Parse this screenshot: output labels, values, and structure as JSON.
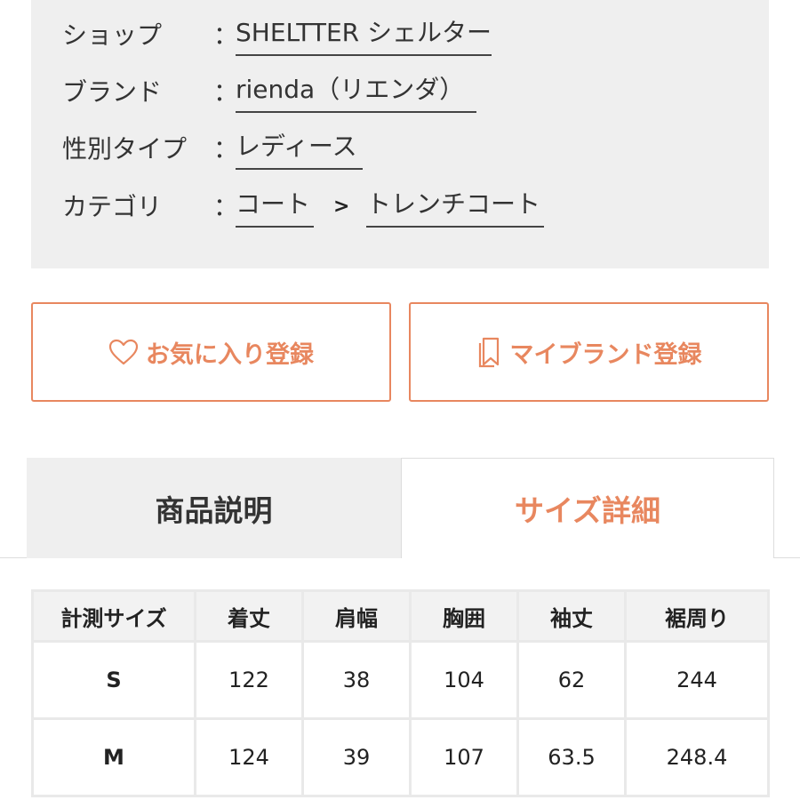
{
  "info": {
    "shop_label": "ショップ",
    "shop_value": "SHELTTER シェルター",
    "brand_label": "ブランド",
    "brand_value": "rienda（リエンダ）",
    "gender_label": "性別タイプ",
    "gender_value": "レディース",
    "category_label": "カテゴリ",
    "category_value": "コート",
    "category_sep": ">",
    "subcategory_value": "トレンチコート",
    "colon": "："
  },
  "buttons": {
    "favorite_label": "お気に入り登録",
    "favorite_icon": "heart-icon",
    "mybrand_label": "マイブランド登録",
    "mybrand_icon": "bookmark-icon",
    "accent_color": "#e8875f"
  },
  "tabs": {
    "description_label": "商品説明",
    "size_label": "サイズ詳細",
    "active": "size"
  },
  "size_table": {
    "headers": [
      "計測サイズ",
      "着丈",
      "肩幅",
      "胸囲",
      "袖丈",
      "裾周り"
    ],
    "rows": [
      [
        "S",
        "122",
        "38",
        "104",
        "62",
        "244"
      ],
      [
        "M",
        "124",
        "39",
        "107",
        "63.5",
        "248.4"
      ]
    ]
  }
}
